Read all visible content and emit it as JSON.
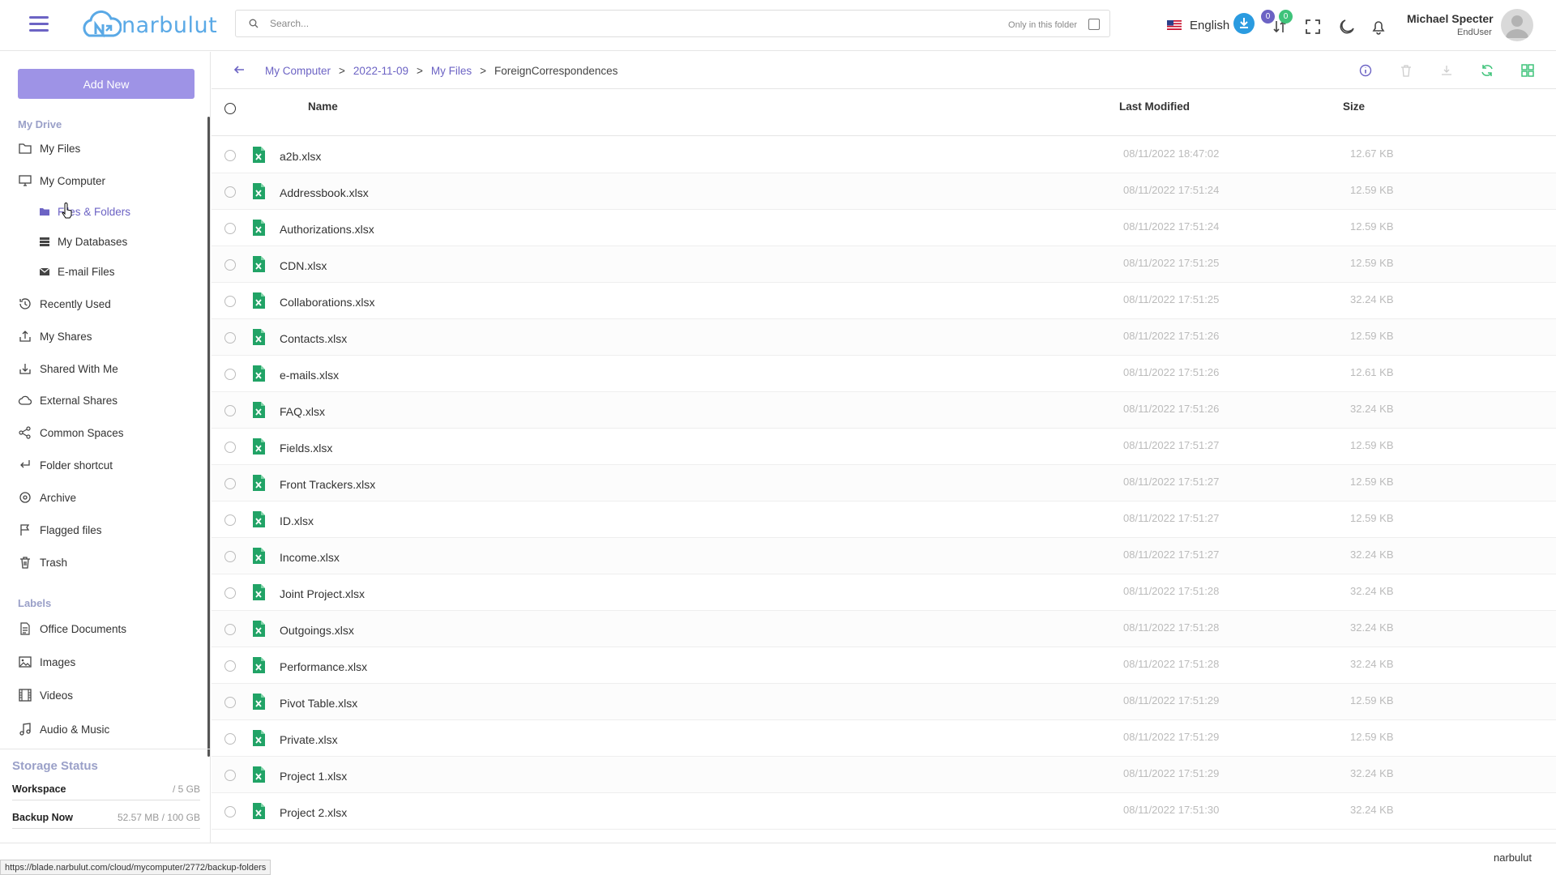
{
  "header": {
    "logo_text": "narbulut",
    "search_placeholder": "Search...",
    "only_folder_label": "Only in this folder",
    "language": "English",
    "badge_uploads": "0",
    "badge_downloads": "0",
    "user_name": "Michael Specter",
    "user_role": "EndUser"
  },
  "sidebar": {
    "add_new": "Add New",
    "section_drive": "My Drive",
    "my_files": "My Files",
    "my_computer": "My Computer",
    "files_folders": "Files & Folders",
    "my_databases": "My Databases",
    "email_files": "E-mail Files",
    "recently_used": "Recently Used",
    "my_shares": "My Shares",
    "shared_with_me": "Shared With Me",
    "external_shares": "External Shares",
    "common_spaces": "Common Spaces",
    "folder_shortcut": "Folder shortcut",
    "archive": "Archive",
    "flagged_files": "Flagged files",
    "trash": "Trash",
    "section_labels": "Labels",
    "office_documents": "Office Documents",
    "images": "Images",
    "videos": "Videos",
    "audio_music": "Audio & Music",
    "storage_title": "Storage Status",
    "workspace_label": "Workspace",
    "workspace_value": "/ 5 GB",
    "backup_label": "Backup Now",
    "backup_value": "52.57 MB / 100 GB"
  },
  "breadcrumb": {
    "c1": "My Computer",
    "c2": "2022-11-09",
    "c3": "My Files",
    "current": "ForeignCorrespondences",
    "sep": ">"
  },
  "table": {
    "col_name": "Name",
    "col_modified": "Last Modified",
    "col_size": "Size",
    "rows": [
      {
        "name": "a2b.xlsx",
        "date": "08/11/2022 18:47:02",
        "size": "12.67 KB"
      },
      {
        "name": "Addressbook.xlsx",
        "date": "08/11/2022 17:51:24",
        "size": "12.59 KB"
      },
      {
        "name": "Authorizations.xlsx",
        "date": "08/11/2022 17:51:24",
        "size": "12.59 KB"
      },
      {
        "name": "CDN.xlsx",
        "date": "08/11/2022 17:51:25",
        "size": "12.59 KB"
      },
      {
        "name": "Collaborations.xlsx",
        "date": "08/11/2022 17:51:25",
        "size": "32.24 KB"
      },
      {
        "name": "Contacts.xlsx",
        "date": "08/11/2022 17:51:26",
        "size": "12.59 KB"
      },
      {
        "name": "e-mails.xlsx",
        "date": "08/11/2022 17:51:26",
        "size": "12.61 KB"
      },
      {
        "name": "FAQ.xlsx",
        "date": "08/11/2022 17:51:26",
        "size": "32.24 KB"
      },
      {
        "name": "Fields.xlsx",
        "date": "08/11/2022 17:51:27",
        "size": "12.59 KB"
      },
      {
        "name": "Front Trackers.xlsx",
        "date": "08/11/2022 17:51:27",
        "size": "12.59 KB"
      },
      {
        "name": "ID.xlsx",
        "date": "08/11/2022 17:51:27",
        "size": "12.59 KB"
      },
      {
        "name": "Income.xlsx",
        "date": "08/11/2022 17:51:27",
        "size": "32.24 KB"
      },
      {
        "name": "Joint Project.xlsx",
        "date": "08/11/2022 17:51:28",
        "size": "32.24 KB"
      },
      {
        "name": "Outgoings.xlsx",
        "date": "08/11/2022 17:51:28",
        "size": "32.24 KB"
      },
      {
        "name": "Performance.xlsx",
        "date": "08/11/2022 17:51:28",
        "size": "32.24 KB"
      },
      {
        "name": "Pivot Table.xlsx",
        "date": "08/11/2022 17:51:29",
        "size": "12.59 KB"
      },
      {
        "name": "Private.xlsx",
        "date": "08/11/2022 17:51:29",
        "size": "12.59 KB"
      },
      {
        "name": "Project 1.xlsx",
        "date": "08/11/2022 17:51:29",
        "size": "32.24 KB"
      },
      {
        "name": "Project 2.xlsx",
        "date": "08/11/2022 17:51:30",
        "size": "32.24 KB"
      }
    ]
  },
  "footer": {
    "brand": "narbulut",
    "status_url": "https://blade.narbulut.com/cloud/mycomputer/2772/backup-folders"
  },
  "colors": {
    "accent": "#6c63c4",
    "button": "#9e93e6",
    "excel": "#21a366",
    "refresh": "#3fc37a"
  }
}
